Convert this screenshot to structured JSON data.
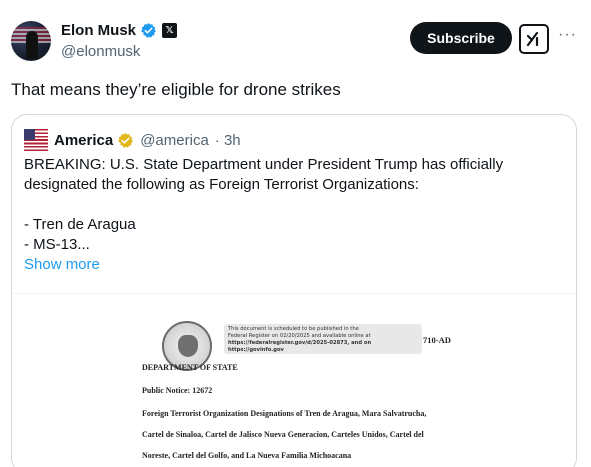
{
  "tweet": {
    "author_name": "Elon Musk",
    "author_handle": "@elonmusk",
    "subscribe_label": "Subscribe",
    "more_label": "···",
    "text": "That means they’re eligible for drone strikes"
  },
  "quote": {
    "author_name": "America",
    "author_handle": "@america",
    "time": "· 3h",
    "lines": [
      "BREAKING: U.S. State Department under President Trump has officially",
      "designated the following as Foreign Terrorist Organizations:",
      "",
      "- Tren de Aragua",
      "- MS-13..."
    ],
    "show_more": "Show more"
  },
  "document": {
    "stamp_lines": [
      "This document is scheduled to be published in the",
      "Federal Register on 02/20/2025 and available online at",
      "https://federalregister.gov/d/2025-02873, and on https://govinfo.gov"
    ],
    "doc_number": "710-AD",
    "department": "DEPARTMENT OF STATE",
    "public_notice": "Public Notice: 12672",
    "line1": "Foreign Terrorist Organization Designations of Tren de Aragua, Mara Salvatrucha,",
    "line2": "Cartel de Sinaloa, Cartel de Jalisco Nueva Generacion, Carteles Unidos, Cartel del",
    "line3": "Noreste, Cartel del Golfo, and La Nueva Familia Michoacana"
  },
  "colors": {
    "text": "#0f1419",
    "muted": "#536471",
    "link": "#1d9bf0",
    "verified_blue": "#1d9bf0",
    "verified_gold": "#e2b719",
    "border": "#cfd9de"
  },
  "icons": {
    "verified": "verified-badge-icon",
    "x_affiliation": "x-logo-icon",
    "grok": "grok-icon",
    "more": "more-icon"
  }
}
